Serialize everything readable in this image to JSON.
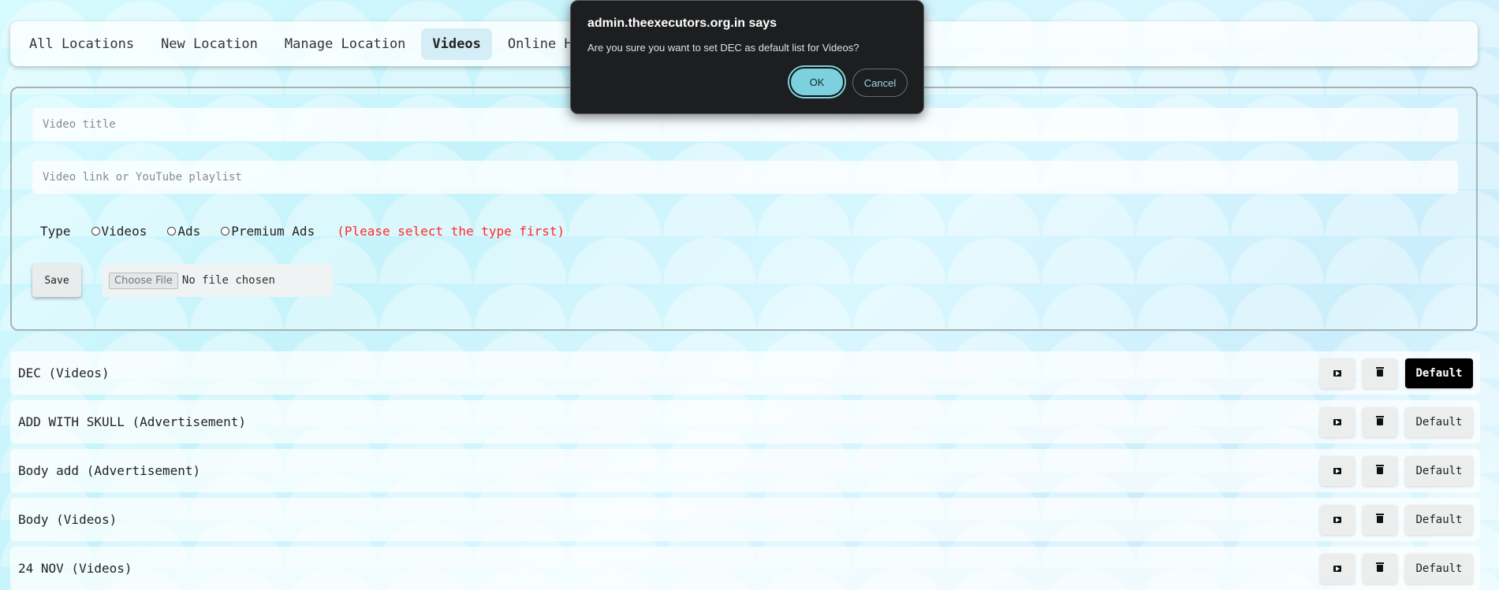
{
  "nav": {
    "items": [
      {
        "label": "All Locations",
        "active": false
      },
      {
        "label": "New Location",
        "active": false
      },
      {
        "label": "Manage Location",
        "active": false
      },
      {
        "label": "Videos",
        "active": true
      },
      {
        "label": "Online Histo",
        "active": false
      }
    ]
  },
  "form": {
    "title_placeholder": "Video title",
    "link_placeholder": "Video link or YouTube playlist",
    "type_label": "Type",
    "type_options": [
      "Videos",
      "Ads",
      "Premium Ads"
    ],
    "type_warning": "(Please select the type first)",
    "save_label": "Save",
    "choose_file_label": "Choose File",
    "file_status": "No file chosen"
  },
  "videos": [
    {
      "title": "DEC (Videos)",
      "default_label": "Default",
      "is_default": true
    },
    {
      "title": "ADD WITH SKULL (Advertisement)",
      "default_label": "Default",
      "is_default": false
    },
    {
      "title": "Body add (Advertisement)",
      "default_label": "Default",
      "is_default": false
    },
    {
      "title": "Body (Videos)",
      "default_label": "Default",
      "is_default": false
    },
    {
      "title": "24 NOV (Videos)",
      "default_label": "Default",
      "is_default": false
    }
  ],
  "dialog": {
    "title": "admin.theexecutors.org.in says",
    "message": "Are you sure you want to set DEC as default list for Videos?",
    "ok_label": "OK",
    "cancel_label": "Cancel"
  },
  "icons": {
    "play": "play-icon",
    "delete": "trash-icon"
  }
}
